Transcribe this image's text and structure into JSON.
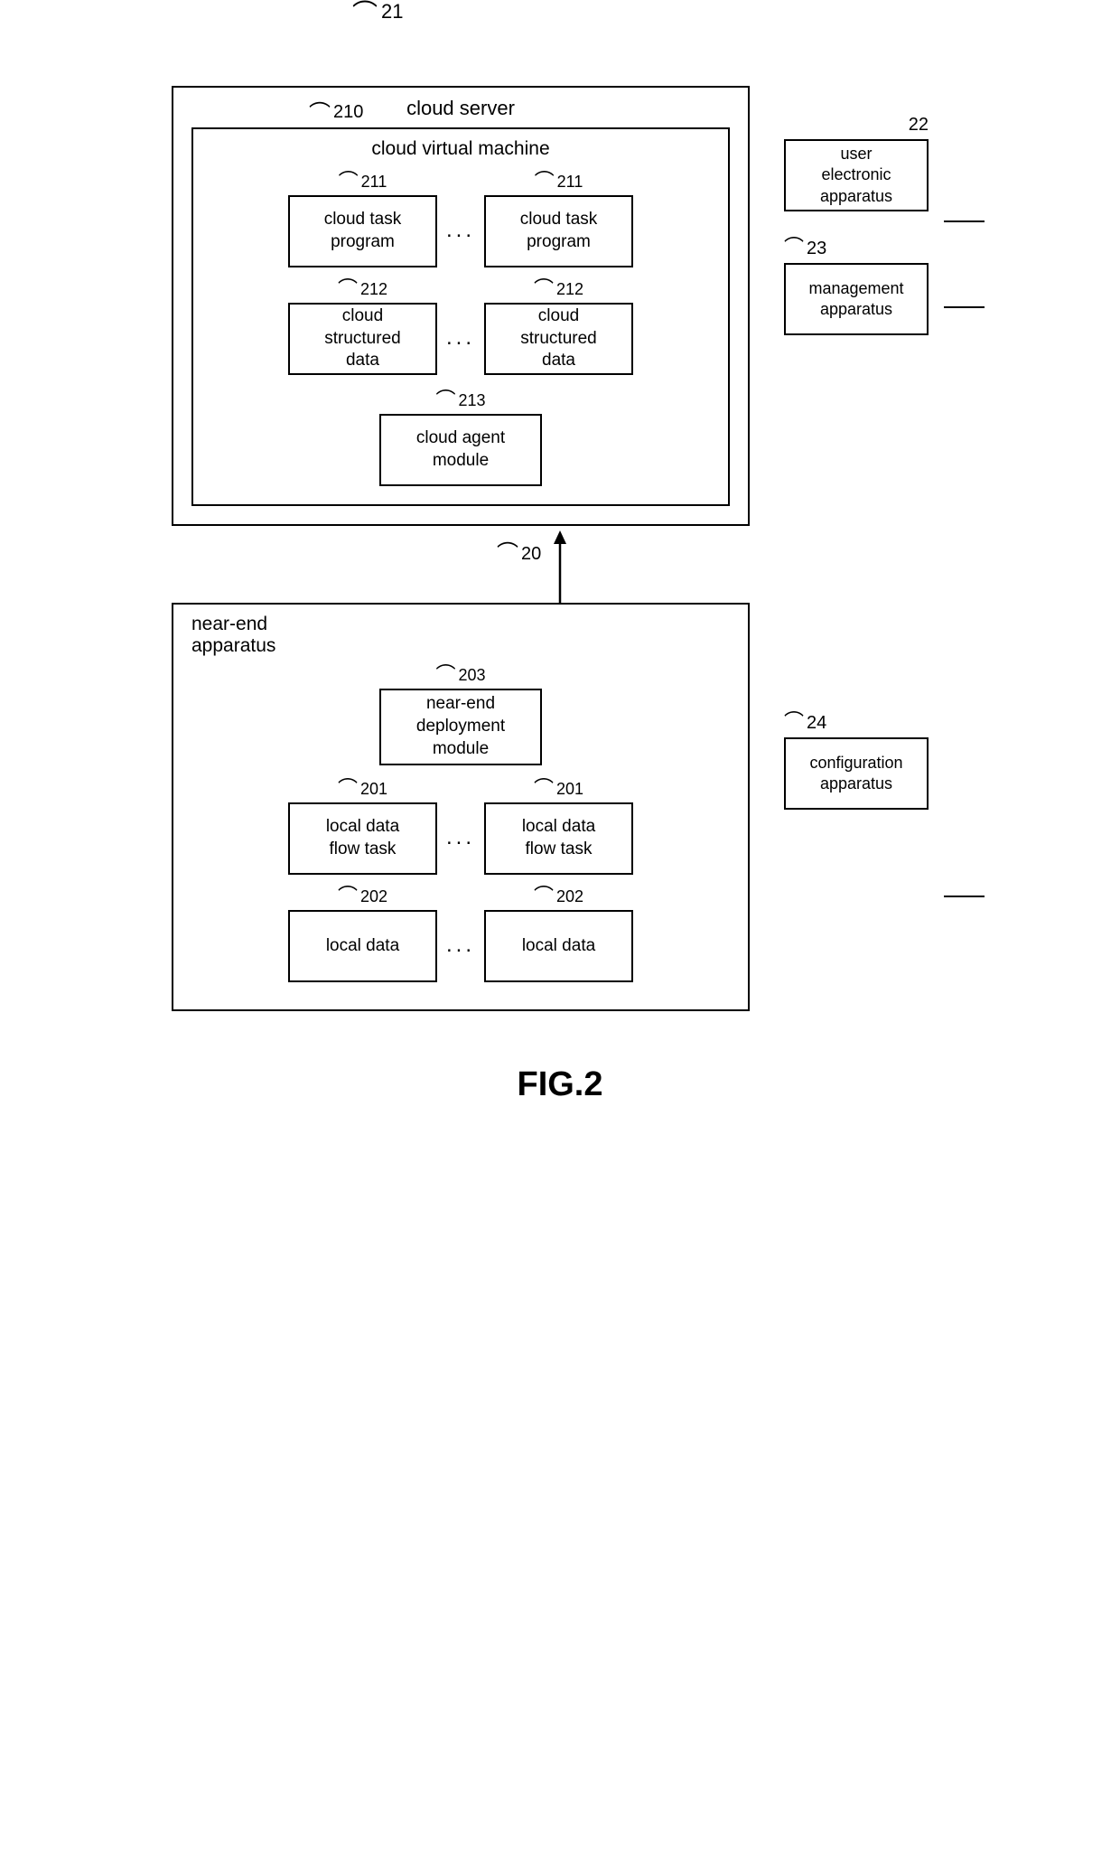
{
  "diagram": {
    "title": "FIG.2",
    "ref_21": "21",
    "ref_22": "22",
    "ref_23": "23",
    "ref_24": "24",
    "ref_20": "20",
    "ref_210": "210",
    "ref_211a": "211",
    "ref_211b": "211",
    "ref_212a": "212",
    "ref_212b": "212",
    "ref_213": "213",
    "ref_201a": "201",
    "ref_201b": "201",
    "ref_202a": "202",
    "ref_202b": "202",
    "ref_203": "203",
    "cloud_server_label": "cloud server",
    "cloud_vm_label": "cloud virtual machine",
    "cloud_task_program": "cloud task\nprogram",
    "cloud_structured_data": "cloud\nstructured\ndata",
    "cloud_agent_module": "cloud agent\nmodule",
    "user_electronic": "user\nelectronic\napparatus",
    "management_apparatus": "management\napparatus",
    "near_end_apparatus_label": "near-end\napparatus",
    "near_end_deployment": "near-end\ndeployment\nmodule",
    "local_data_flow_task": "local data\nflow task",
    "local_data": "local data",
    "configuration_apparatus": "configuration\napparatus",
    "dots": "...",
    "fig_label": "FIG.2"
  }
}
